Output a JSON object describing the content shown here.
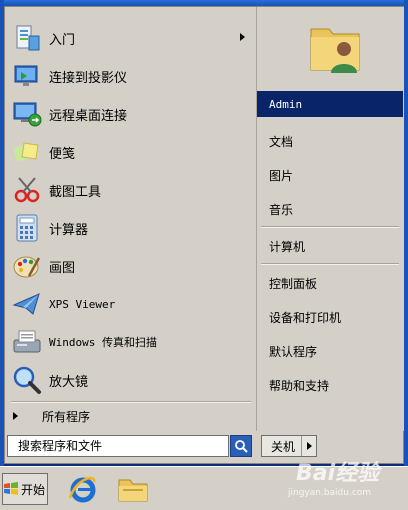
{
  "programs": [
    {
      "label": "入门",
      "icon": "getting-started-icon",
      "has_submenu": true
    },
    {
      "label": "连接到投影仪",
      "icon": "projector-icon"
    },
    {
      "label": "远程桌面连接",
      "icon": "remote-desktop-icon"
    },
    {
      "label": "便笺",
      "icon": "sticky-notes-icon"
    },
    {
      "label": "截图工具",
      "icon": "snipping-tool-icon"
    },
    {
      "label": "计算器",
      "icon": "calculator-icon"
    },
    {
      "label": "画图",
      "icon": "paint-icon"
    },
    {
      "label": "XPS Viewer",
      "icon": "xps-viewer-icon"
    },
    {
      "label": "Windows 传真和扫描",
      "icon": "fax-scan-icon"
    },
    {
      "label": "放大镜",
      "icon": "magnifier-icon"
    }
  ],
  "all_programs": "所有程序",
  "search": {
    "placeholder": "搜索程序和文件"
  },
  "shutdown": {
    "label": "关机"
  },
  "right_items": {
    "user": "Admin",
    "documents": "文档",
    "pictures": "图片",
    "music": "音乐",
    "computer": "计算机",
    "control_panel": "控制面板",
    "devices": "设备和打印机",
    "default_programs": "默认程序",
    "help": "帮助和支持"
  },
  "taskbar": {
    "start_label": "开始"
  },
  "watermark": {
    "brand": "Bai经验",
    "site": "jingyan.baidu.com"
  },
  "colors": {
    "selection": "#0a246a",
    "menu_bg": "#d4d0c8"
  }
}
